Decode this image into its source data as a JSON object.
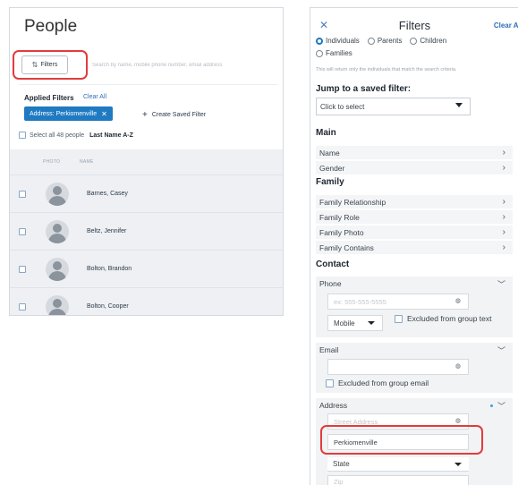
{
  "people": {
    "title": "People",
    "filters_button": "Filters",
    "search_placeholder": "Search by name, mobile phone number, email address",
    "applied_filters_title": "Applied Filters",
    "clear_all": "Clear All",
    "chip_label": "Address: Perkiomenville",
    "create_saved_filter": "Create Saved Filter",
    "select_all": "Select all 48 people",
    "sort_label": "Last Name A-Z",
    "columns": {
      "photo": "PHOTO",
      "name": "NAME"
    },
    "rows": [
      {
        "name": "Barnes, Casey"
      },
      {
        "name": "Beltz, Jennifer"
      },
      {
        "name": "Bolton, Brandon"
      },
      {
        "name": "Bolton, Cooper"
      }
    ]
  },
  "filters": {
    "title": "Filters",
    "clear_all": "Clear All",
    "radio_options": [
      "Individuals",
      "Parents",
      "Children",
      "Families"
    ],
    "hint": "This will return only the individuals that match the search criteria.",
    "jump_title": "Jump to a saved filter:",
    "jump_select": "Click to select",
    "main_title": "Main",
    "main_items": [
      "Name",
      "Gender"
    ],
    "family_title": "Family",
    "family_items": [
      "Family Relationship",
      "Family Role",
      "Family Photo",
      "Family Contains"
    ],
    "contact_title": "Contact",
    "phone": {
      "label": "Phone",
      "placeholder": "ex: 555-555-5555",
      "type": "Mobile",
      "excluded": "Excluded from group text"
    },
    "email": {
      "label": "Email",
      "value": "",
      "excluded": "Excluded from group email"
    },
    "address": {
      "label": "Address",
      "street_placeholder": "Street Address",
      "city_value": "Perkiomenville",
      "state_label": "State",
      "zip_placeholder": "Zip"
    }
  },
  "colors": {
    "accent": "#1f7ac2",
    "highlight": "#e23c3c",
    "link": "#2f6fb5"
  },
  "icons": {
    "filter": "filter-icon",
    "close": "close-icon",
    "chevron_right": "chevron-right-icon",
    "chevron_down": "chevron-down-icon"
  }
}
